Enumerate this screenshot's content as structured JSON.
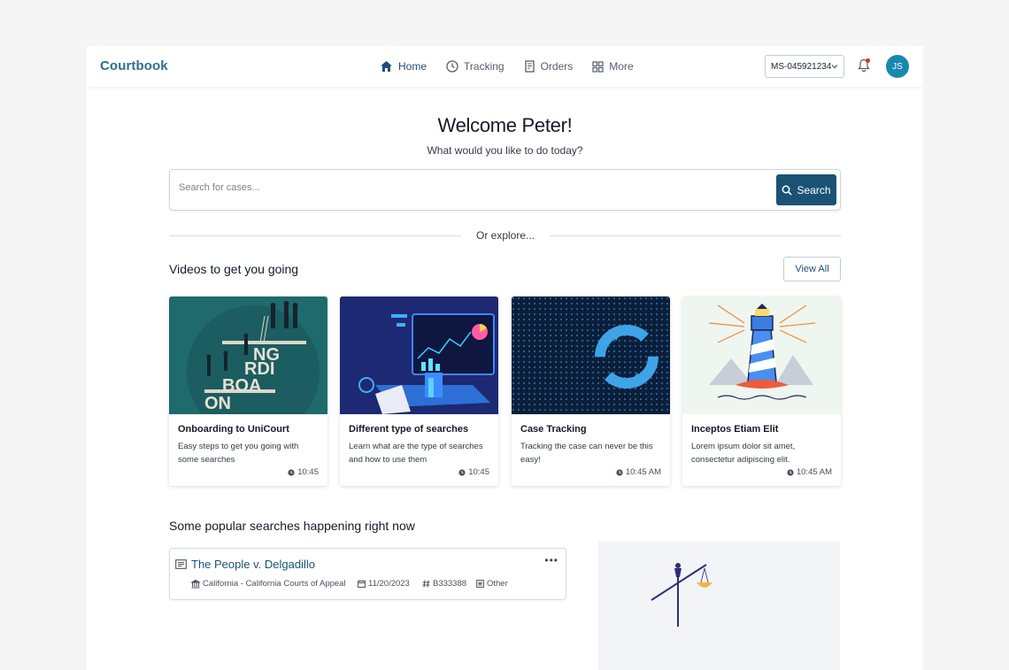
{
  "header": {
    "brand": "Courtbook",
    "nav": [
      {
        "label": "Home",
        "icon": "home-icon",
        "active": true
      },
      {
        "label": "Tracking",
        "icon": "clock-icon",
        "active": false
      },
      {
        "label": "Orders",
        "icon": "receipt-icon",
        "active": false
      },
      {
        "label": "More",
        "icon": "grid-icon",
        "active": false
      }
    ],
    "account_id": "MS-045921234",
    "avatar_initials": "JS"
  },
  "hero": {
    "title": "Welcome Peter!",
    "subtitle": "What would you like to do today?",
    "search_placeholder": "Search for cases...",
    "search_value": "",
    "search_button": "Search",
    "explore_label": "Or explore..."
  },
  "videos": {
    "heading": "Videos to get you going",
    "view_all": "View All",
    "items": [
      {
        "title": "Onboarding to UniCourt",
        "description": "Easy steps to get you going with some searches",
        "duration": "10:45",
        "thumb_words": [
          "NG",
          "RDI",
          "BOA",
          "ON"
        ]
      },
      {
        "title": "Different type of searches",
        "description": "Learn what are the type of searches and how to use them",
        "duration": "10:45"
      },
      {
        "title": "Case Tracking",
        "description": "Tracking the case can never be this easy!",
        "duration": "10:45 AM"
      },
      {
        "title": "Inceptos Etiam Elit",
        "description": "Lorem ipsum dolor sit amet, consectetur adipiscing elit.",
        "duration": "10:45 AM"
      }
    ]
  },
  "popular": {
    "heading": "Some popular searches happening right now",
    "results": [
      {
        "title": "The People v. Delgadillo",
        "court": "California - California Courts of Appeal",
        "date": "11/20/2023",
        "case_number": "B333388",
        "category": "Other",
        "more_label": "•••"
      }
    ]
  },
  "colors": {
    "brand": "#2f6f8f",
    "primary": "#1a5276",
    "avatar": "#1888b0"
  }
}
